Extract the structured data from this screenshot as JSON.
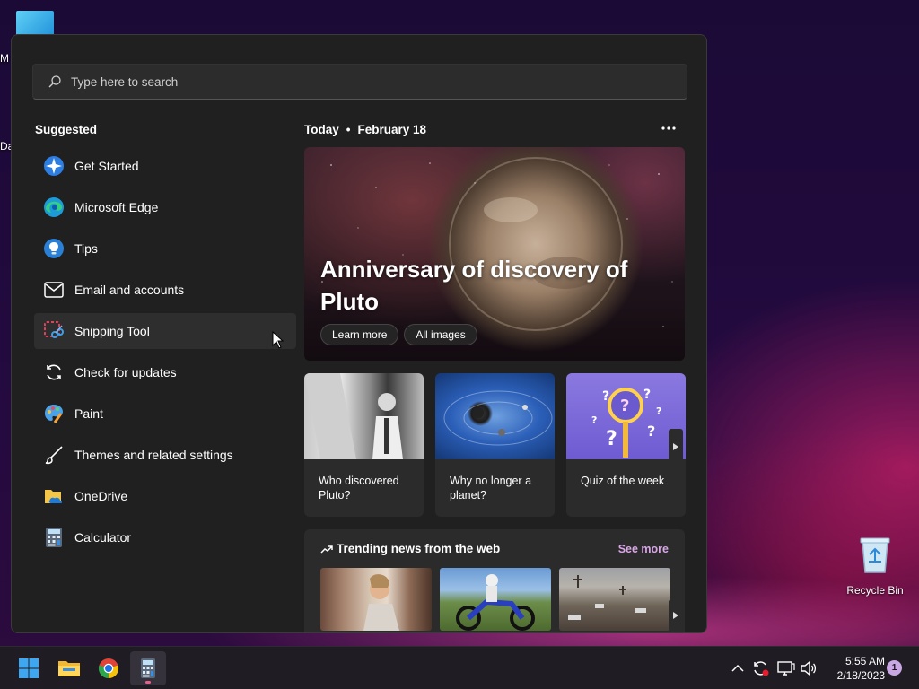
{
  "desktop": {
    "left_edge_labels": [
      "M",
      "Da"
    ],
    "recycle_bin_label": "Recycle Bin"
  },
  "start_menu": {
    "search": {
      "placeholder": "Type here to search",
      "value": ""
    },
    "suggested_title": "Suggested",
    "suggested_items": [
      {
        "label": "Get Started",
        "icon": "get-started-icon"
      },
      {
        "label": "Microsoft Edge",
        "icon": "edge-icon"
      },
      {
        "label": "Tips",
        "icon": "tips-lightbulb-icon"
      },
      {
        "label": "Email and accounts",
        "icon": "mail-icon"
      },
      {
        "label": "Snipping Tool",
        "icon": "snipping-tool-icon",
        "hovered": true
      },
      {
        "label": "Check for updates",
        "icon": "refresh-icon"
      },
      {
        "label": "Paint",
        "icon": "paint-palette-icon"
      },
      {
        "label": "Themes and related settings",
        "icon": "brush-icon"
      },
      {
        "label": "OneDrive",
        "icon": "onedrive-folder-icon"
      },
      {
        "label": "Calculator",
        "icon": "calculator-icon"
      }
    ],
    "today": {
      "label": "Today",
      "separator": "•",
      "date": "February 18",
      "more_icon": "more-dots-icon"
    },
    "hero": {
      "title": "Anniversary of discovery of Pluto",
      "learn_more": "Learn more",
      "all_images": "All images"
    },
    "cards": [
      {
        "caption": "Who discovered Pluto?"
      },
      {
        "caption": "Why no longer a planet?"
      },
      {
        "caption": "Quiz of the week"
      }
    ],
    "news": {
      "title": "Trending news from the web",
      "see_more": "See more"
    }
  },
  "taskbar": {
    "apps": [
      "windows-start-icon",
      "file-explorer-icon",
      "chrome-icon",
      "calculator-icon"
    ],
    "tray_icons": [
      "chevron-up-icon",
      "sync-alert-icon",
      "network-icon",
      "volume-icon"
    ],
    "time": "5:55 AM",
    "date": "2/18/2023",
    "notification_count": "1"
  },
  "colors": {
    "accent": "#d9a6e8",
    "active_indicator": "#e8618c",
    "menu_bg": "#202020"
  }
}
